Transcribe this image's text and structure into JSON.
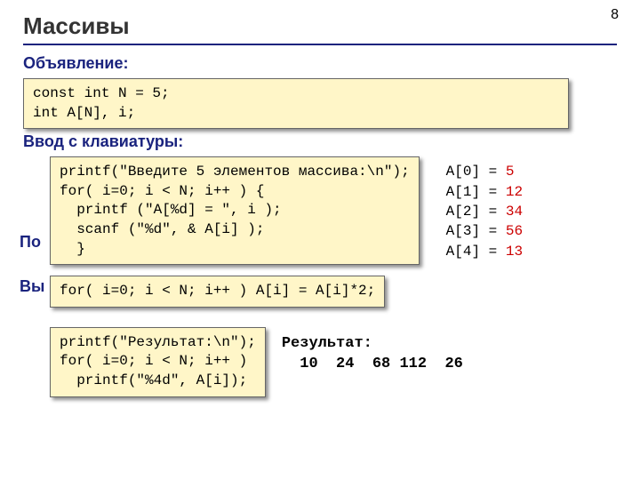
{
  "page_number": "8",
  "title": "Массивы",
  "labels": {
    "declaration": "Объявление:",
    "input": "Ввод с клавиатуры:",
    "elementwise": "По",
    "output": "Вы"
  },
  "code": {
    "declaration": "const int N = 5;\nint A[N], i;",
    "input": "printf(\"Введите 5 элементов массива:\\n\");\nfor( i=0; i < N; i++ ) {\n  printf (\"A[%d] = \", i );\n  scanf (\"%d\", & A[i] );\n  }",
    "double": "for( i=0; i < N; i++ ) A[i] = A[i]*2;",
    "print": "printf(\"Результат:\\n\");\nfor( i=0; i < N; i++ )\n  printf(\"%4d\", A[i]);"
  },
  "sample_input": [
    {
      "label": "A[0] =",
      "value": "5"
    },
    {
      "label": "A[1] =",
      "value": "12"
    },
    {
      "label": "A[2] =",
      "value": "34"
    },
    {
      "label": "A[3] =",
      "value": "56"
    },
    {
      "label": "A[4] =",
      "value": "13"
    }
  ],
  "result": {
    "heading": "Результат:",
    "values": "  10  24  68 112  26"
  }
}
